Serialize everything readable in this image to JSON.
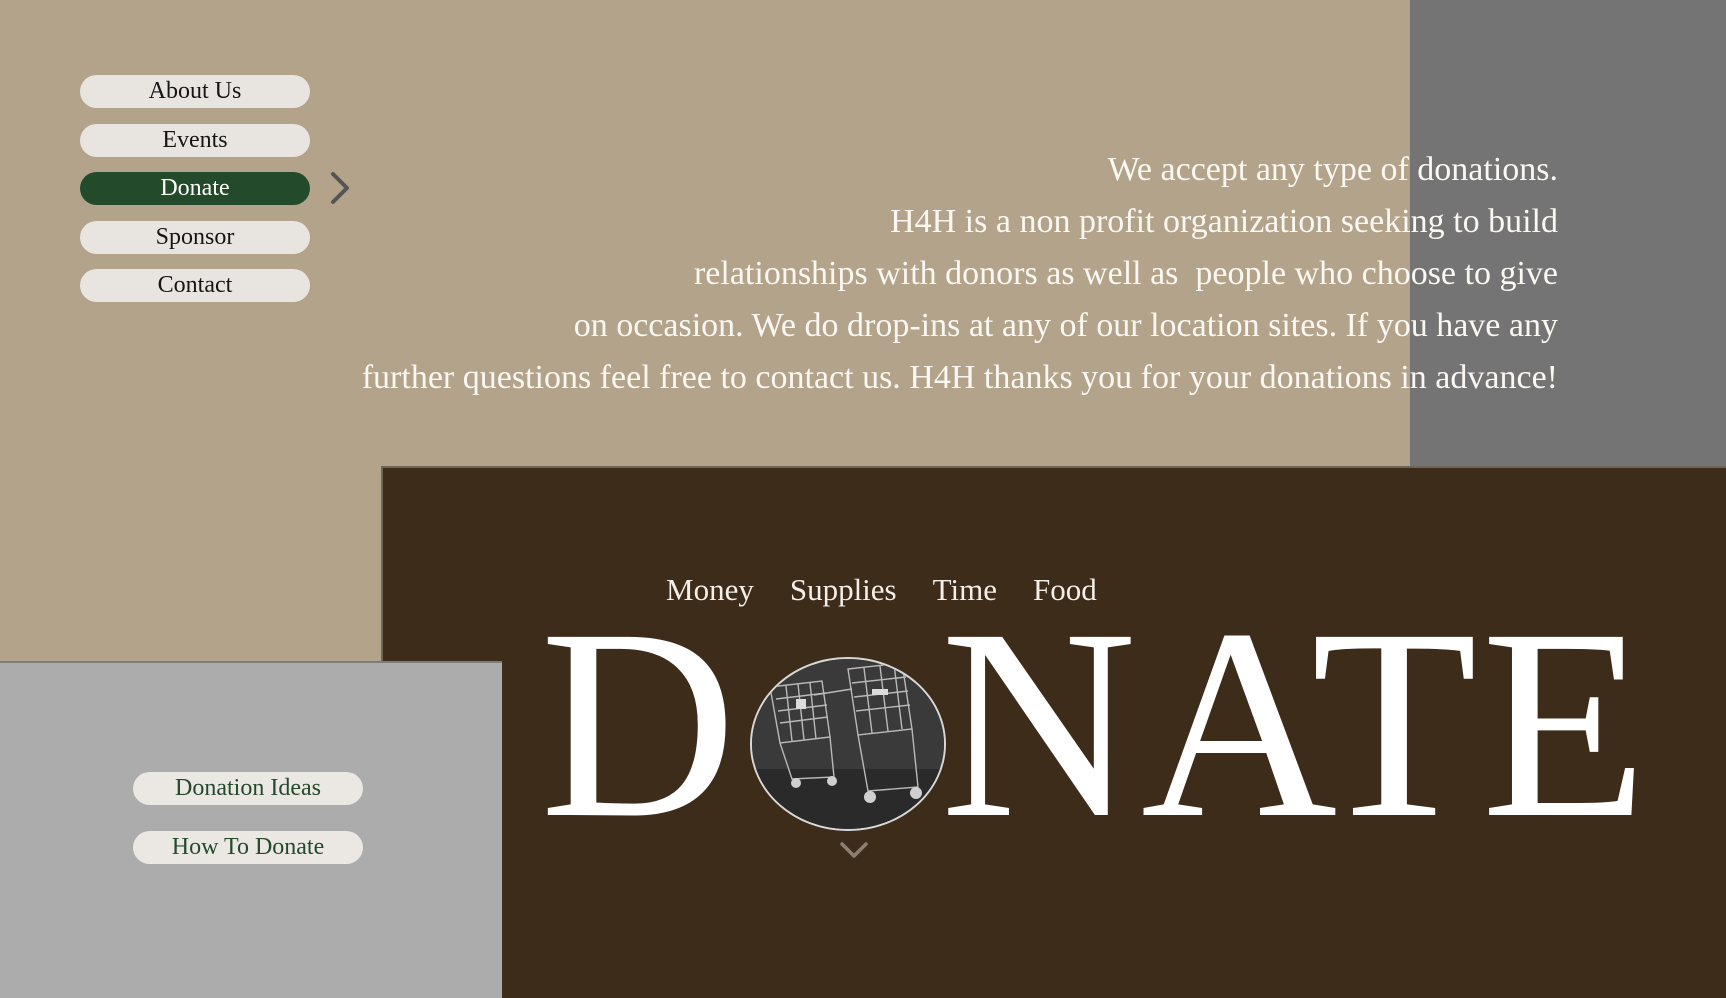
{
  "nav": {
    "items": [
      {
        "label": "About Us",
        "active": false
      },
      {
        "label": "Events",
        "active": false
      },
      {
        "label": "Donate",
        "active": true
      },
      {
        "label": "Sponsor",
        "active": false
      },
      {
        "label": "Contact",
        "active": false
      }
    ],
    "active_indicator_icon": "chevron-right-icon"
  },
  "intro": {
    "lines": [
      "We accept any type of donations.",
      "H4H is a non profit organization seeking to build",
      "relationships with donors as well as  people who choose to give",
      "on occasion. We do drop-ins at any of our location sites. If you have any",
      "further questions feel free to contact us. H4H thanks you for your donations in advance!"
    ]
  },
  "categories": [
    "Money",
    "Supplies",
    "Time",
    "Food"
  ],
  "hero": {
    "word_before": "D",
    "word_after": "NATE",
    "image_subject": "shopping carts photo"
  },
  "scroll_icon": "chevron-down-icon",
  "side_links": [
    "Donation Ideas",
    "How To Donate"
  ],
  "colors": {
    "tan": "#b3a38a",
    "brown": "#3e2c1a",
    "gray_right": "#747474",
    "gray_left": "#acacac",
    "accent_green": "#234a2b",
    "button_bg": "#e8e5e1"
  }
}
